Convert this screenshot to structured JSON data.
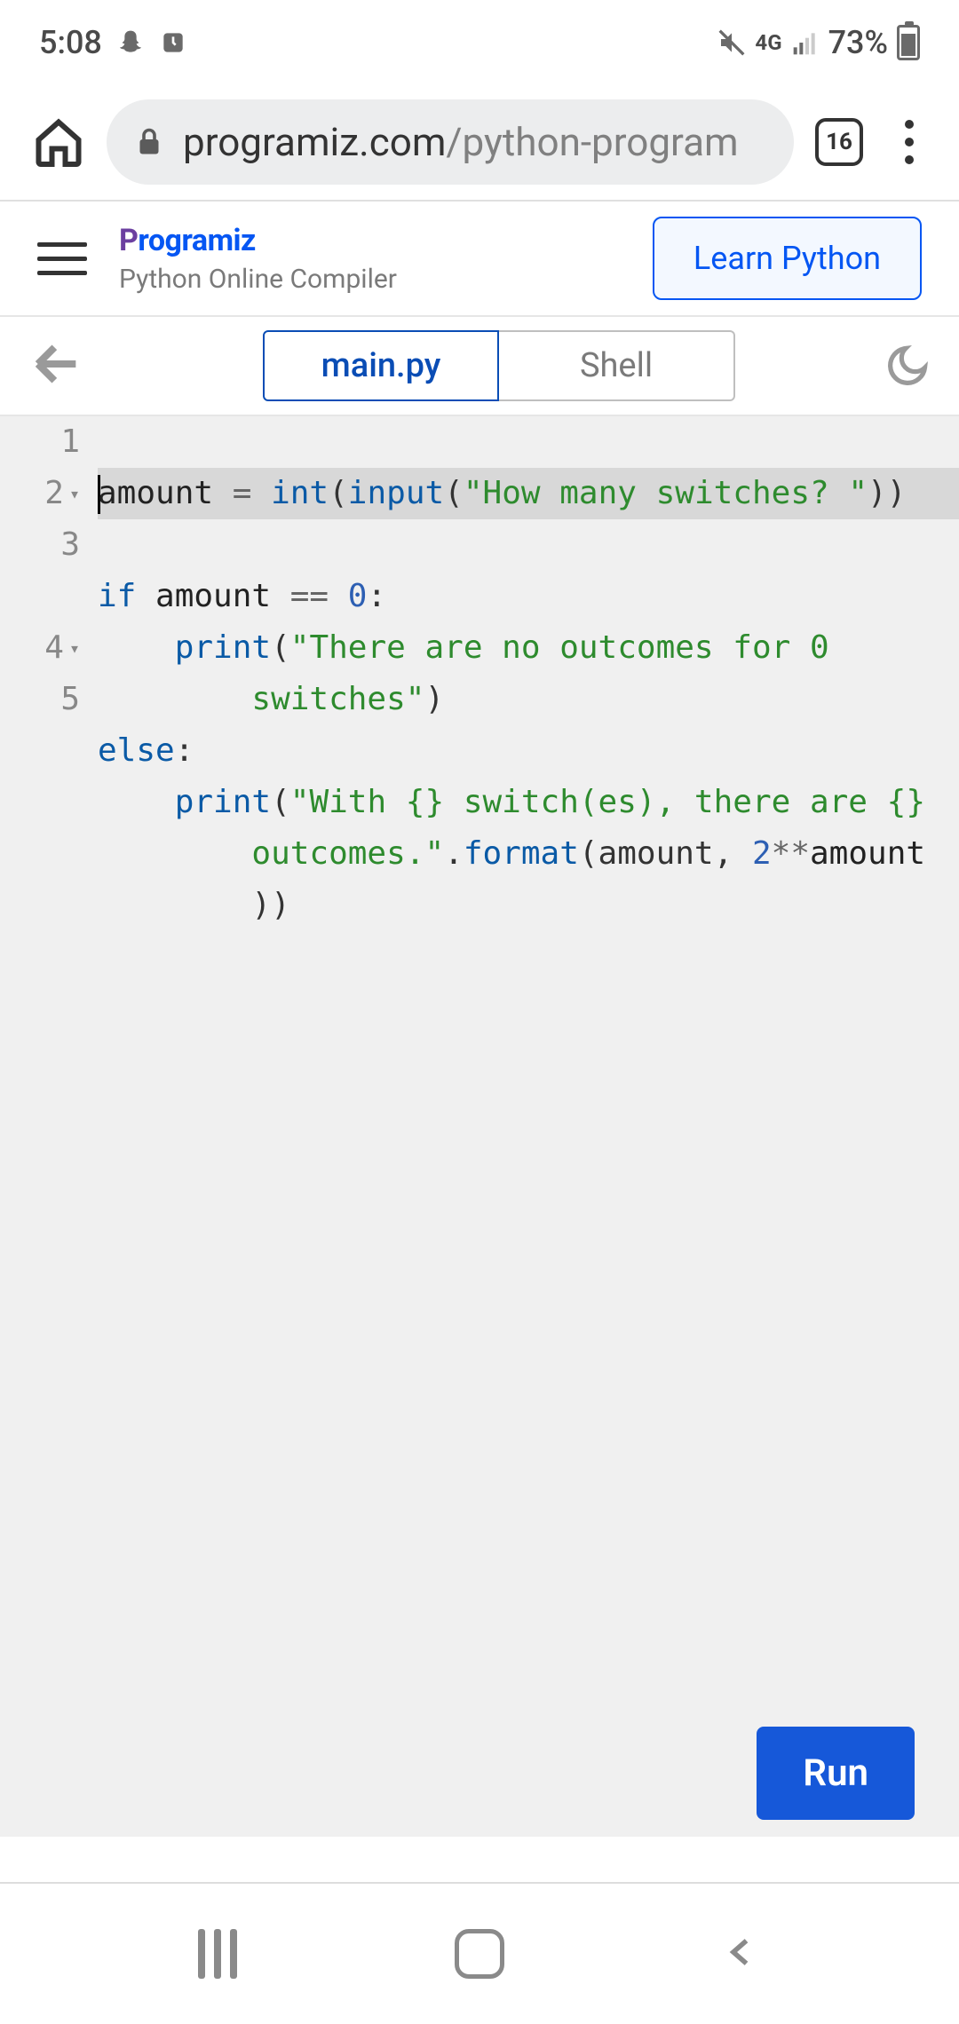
{
  "status": {
    "time": "5:08",
    "network": "4G",
    "battery_pct": "73%"
  },
  "browser": {
    "url_host": "programiz.com",
    "url_path": "/python-program",
    "tab_count": "16"
  },
  "app": {
    "brand": "rogramiz",
    "subtitle": "Python Online Compiler",
    "learn_button": "Learn Python"
  },
  "tabs": {
    "main": "main.py",
    "shell": "Shell"
  },
  "editor": {
    "lines": [
      {
        "n": "1",
        "fold": false
      },
      {
        "n": "2",
        "fold": true
      },
      {
        "n": "3",
        "fold": false
      },
      {
        "n": "4",
        "fold": true
      },
      {
        "n": "5",
        "fold": false
      }
    ],
    "code": {
      "l1_a": "amount ",
      "l1_eq": "= ",
      "l1_int": "int",
      "l1_p1": "(",
      "l1_input": "input",
      "l1_p2": "(",
      "l1_str": "\"How many switches? \"",
      "l1_p3": "))",
      "l2_if": "if",
      "l2_rest": " amount ",
      "l2_eqeq": "==",
      "l2_sp": " ",
      "l2_zero": "0",
      "l2_colon": ":",
      "l3_indent": "    ",
      "l3_print": "print",
      "l3_p1": "(",
      "l3_str_a": "\"There are no outcomes for 0 ",
      "l3_cont_indent": "        ",
      "l3_str_b": "switches\"",
      "l3_p2": ")",
      "l4_else": "else",
      "l4_colon": ":",
      "l5_indent": "    ",
      "l5_print": "print",
      "l5_p1": "(",
      "l5_str_a": "\"With {} switch(es), there are {} ",
      "l5_cont_indent": "        ",
      "l5_str_b": "outcomes.\"",
      "l5_dot": ".",
      "l5_format": "format",
      "l5_args_a": "(amount, ",
      "l5_two": "2",
      "l5_pow": "**",
      "l5_amount2": "amount",
      "l5_cont2_indent": "        ",
      "l5_close": "))"
    }
  },
  "run_button": "Run"
}
